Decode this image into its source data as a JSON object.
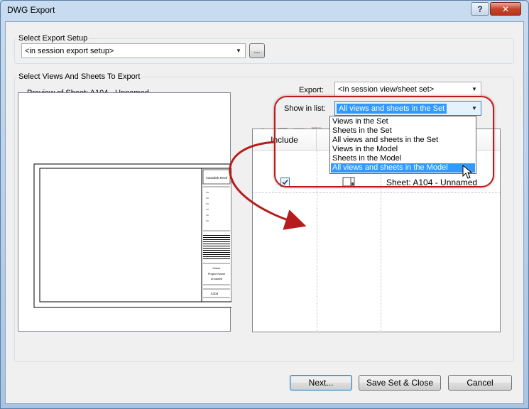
{
  "window": {
    "title": "DWG Export",
    "help_button": "?",
    "close_button": "✕"
  },
  "export_setup": {
    "group_label": "Select Export Setup",
    "combo_value": "<in session export setup>",
    "browse_button": "..."
  },
  "views": {
    "group_label": "Select Views And Sheets To Export",
    "preview_label": "Preview of Sheet: A104 - Unnamed",
    "export_label": "Export:",
    "export_value": "<In session view/sheet set>",
    "show_label": "Show in list:",
    "show_value": "All views and sheets in the Set",
    "dropdown_options": [
      "Views in the Set",
      "Sheets in the Set",
      "All views and sheets in the Set",
      "Views in the Model",
      "Sheets in the Model",
      "All views and sheets in the Model"
    ],
    "dropdown_selected_index": 5,
    "list": {
      "columns": [
        "Include",
        "",
        ""
      ],
      "rows": [
        {
          "include": true,
          "name": "Sheet: A104 - Unnamed"
        }
      ]
    }
  },
  "titleblock": {
    "company": "Autodesk Revit",
    "project": "Project Name",
    "owner": "Owner",
    "sheet_title": "Unnamed",
    "sheet_number": "A104"
  },
  "buttons": {
    "next": "Next...",
    "save_close": "Save Set & Close",
    "cancel": "Cancel"
  },
  "colors": {
    "annotation": "#b71c1c",
    "selection": "#3399ff"
  }
}
